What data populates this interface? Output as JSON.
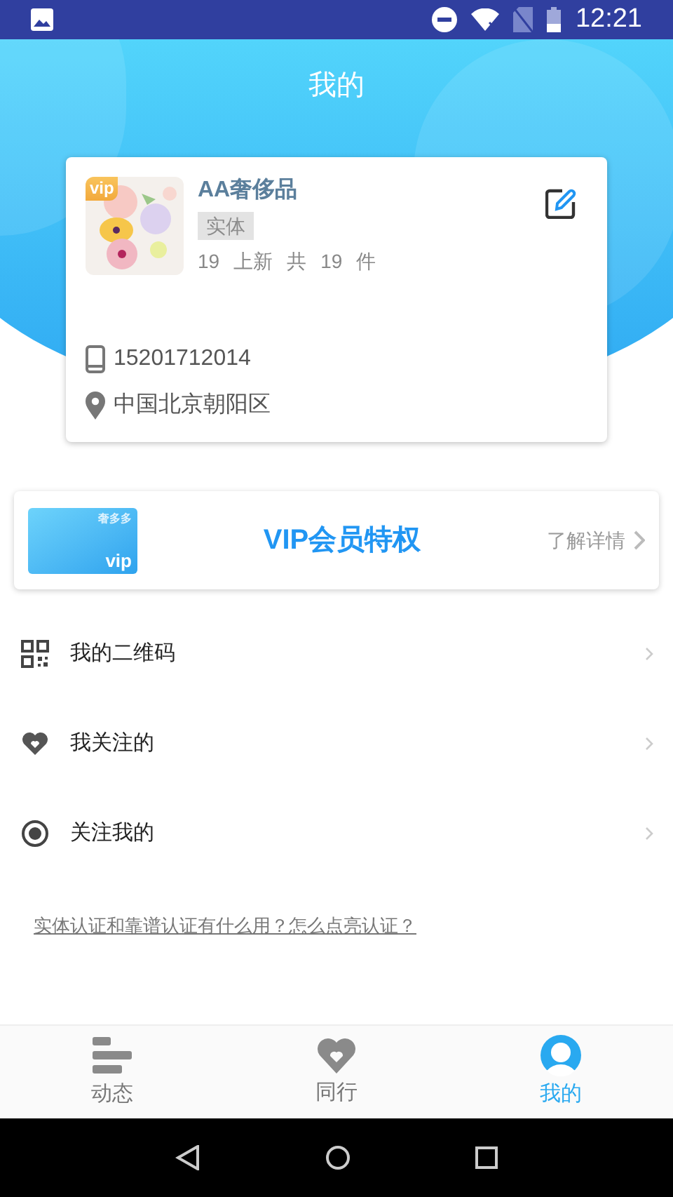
{
  "status_bar": {
    "time": "12:21"
  },
  "header": {
    "title": "我的"
  },
  "profile": {
    "name": "AA奢侈品",
    "vip_badge": "vip",
    "tag": "实体",
    "stats": [
      "19",
      "上新",
      "共",
      "19",
      "件"
    ],
    "phone": "15201712014",
    "location": "中国北京朝阳区"
  },
  "vip_banner": {
    "card_brand": "奢多多",
    "card_label": "vip",
    "title": "VIP会员特权",
    "link": "了解详情"
  },
  "menu": [
    {
      "kind": "qrcode",
      "label": "我的二维码"
    },
    {
      "kind": "heart",
      "label": "我关注的"
    },
    {
      "kind": "eye",
      "label": "关注我的"
    }
  ],
  "help_link": "实体认证和靠谱认证有什么用？怎么点亮认证？",
  "bottom_nav": [
    {
      "kind": "feed",
      "label": "动态",
      "selected": false
    },
    {
      "kind": "heart",
      "label": "同行",
      "selected": false
    },
    {
      "kind": "person",
      "label": "我的",
      "selected": true
    }
  ]
}
